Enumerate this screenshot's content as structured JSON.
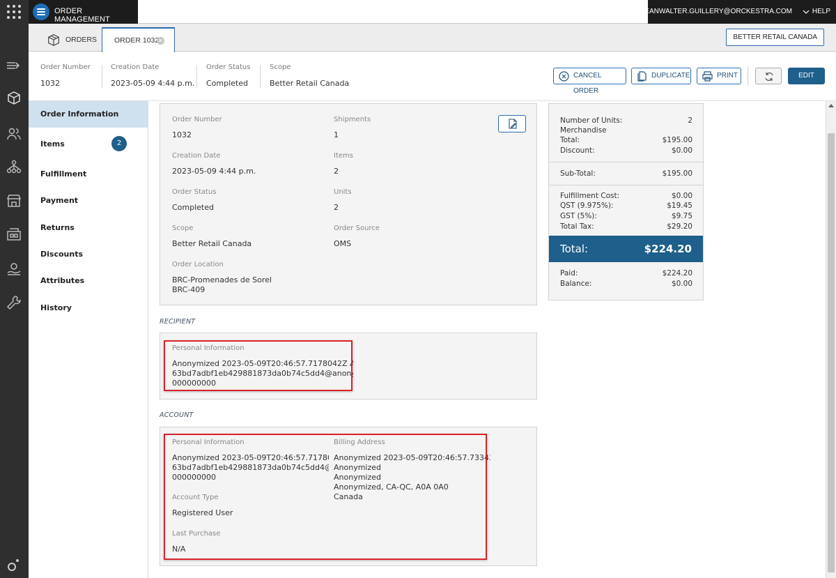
{
  "app": {
    "title": "ORDER MANAGEMENT",
    "user": "JEANWALTER.GUILLERY@ORCKESTRA.COM",
    "help": "HELP"
  },
  "tabs": [
    {
      "label": "ORDERS",
      "icon": "box-icon"
    },
    {
      "label": "ORDER 1032",
      "active": true
    }
  ],
  "scope_button": "BETTER RETAIL CANADA",
  "summary": {
    "order_number": {
      "label": "Order Number",
      "value": "1032"
    },
    "creation_date": {
      "label": "Creation Date",
      "value": "2023-05-09 4:44 p.m."
    },
    "order_status": {
      "label": "Order Status",
      "value": "Completed"
    },
    "scope": {
      "label": "Scope",
      "value": "Better Retail Canada"
    }
  },
  "actions": {
    "cancel": "CANCEL ORDER",
    "duplicate": "DUPLICATE",
    "print": "PRINT",
    "edit": "EDIT"
  },
  "nav": [
    {
      "label": "Order Information",
      "active": true
    },
    {
      "label": "Items",
      "badge": "2"
    },
    {
      "label": "Fulfillment"
    },
    {
      "label": "Payment"
    },
    {
      "label": "Returns"
    },
    {
      "label": "Discounts"
    },
    {
      "label": "Attributes"
    },
    {
      "label": "History"
    }
  ],
  "order_info": {
    "order_number": {
      "label": "Order Number",
      "value": "1032"
    },
    "shipments": {
      "label": "Shipments",
      "value": "1"
    },
    "creation_date": {
      "label": "Creation Date",
      "value": "2023-05-09 4:44 p.m."
    },
    "items": {
      "label": "Items",
      "value": "2"
    },
    "order_status": {
      "label": "Order Status",
      "value": "Completed"
    },
    "units": {
      "label": "Units",
      "value": "2"
    },
    "scope": {
      "label": "Scope",
      "value": "Better Retail Canada"
    },
    "order_source": {
      "label": "Order Source",
      "value": "OMS"
    },
    "order_location": {
      "label": "Order Location",
      "line1": "BRC-Promenades de Sorel",
      "line2": "BRC-409"
    }
  },
  "recipient": {
    "section": "RECIPIENT",
    "label": "Personal Information",
    "name": "Anonymized 2023-05-09T20:46:57.7178042Z Ano...",
    "email": "63bd7adbf1eb429881873da0b74c5dd4@anony...",
    "phone": "000000000"
  },
  "account": {
    "section": "ACCOUNT",
    "personal_label": "Personal Information",
    "name": "Anonymized 2023-05-09T20:46:57.717804...",
    "email": "63bd7adbf1eb429881873da0b74c5dd4@...",
    "phone": "000000000",
    "account_type_label": "Account Type",
    "account_type": "Registered User",
    "last_purchase_label": "Last Purchase",
    "last_purchase": "N/A",
    "billing_label": "Billing Address",
    "billing_line1": "Anonymized 2023-05-09T20:46:57.733430...",
    "billing_line2": "Anonymized",
    "billing_line3": "Anonymized",
    "billing_line4": "Anonymized, CA-QC, A0A 0A0",
    "billing_line5": "Canada"
  },
  "totals": {
    "units_label": "Number of Units:",
    "units": "2",
    "merch_label1": "Merchandise",
    "merch_label2": "Total:",
    "merch": "$195.00",
    "discount_label": "Discount:",
    "discount": "$0.00",
    "subtotal_label": "Sub-Total:",
    "subtotal": "$195.00",
    "fulfillment_label": "Fulfillment Cost:",
    "fulfillment": "$0.00",
    "qst_label": "QST (9.975%):",
    "qst": "$19.45",
    "gst_label": "GST (5%):",
    "gst": "$9.75",
    "tax_label": "Total Tax:",
    "tax": "$29.20",
    "total_label": "Total:",
    "total": "$224.20",
    "paid_label": "Paid:",
    "paid": "$224.20",
    "balance_label": "Balance:",
    "balance": "$0.00"
  },
  "colors": {
    "accent": "#1f5f8b",
    "highlight": "#d9222a",
    "rail": "#2f2f2f"
  }
}
